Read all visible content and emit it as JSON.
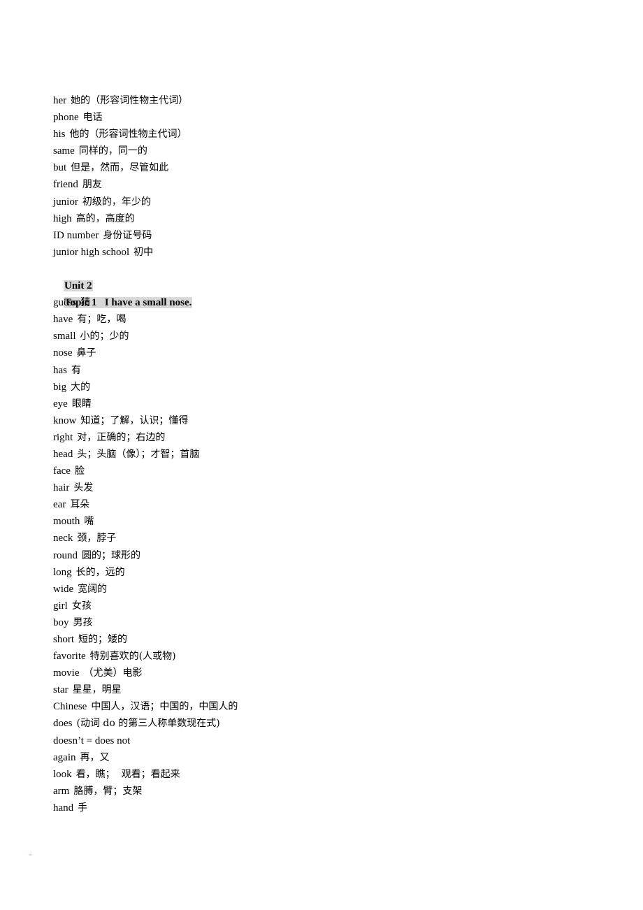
{
  "document": {
    "lines_before": [
      {
        "term": "her",
        "def": "她的（形容词性物主代词）"
      },
      {
        "term": "phone",
        "def": "电话"
      },
      {
        "term": "his",
        "def": "他的（形容词性物主代词）"
      },
      {
        "term": "same",
        "def": "同样的，同一的"
      },
      {
        "term": "but",
        "def": "但是，然而，尽管如此"
      },
      {
        "term": "friend",
        "def": "朋友"
      },
      {
        "term": "junior",
        "def": "初级的，年少的"
      },
      {
        "term": "high",
        "def": "高的，高度的"
      },
      {
        "term": "ID number",
        "def": "身份证号码"
      },
      {
        "term": "junior high school",
        "def": "初中"
      }
    ],
    "unit_heading": "Unit 2",
    "topic_heading": "Topic 1   I have a small nose.",
    "lines_after": [
      {
        "term": "guess",
        "def": "猜"
      },
      {
        "term": "have",
        "def": "有；吃，喝"
      },
      {
        "term": "small",
        "def": "小的；少的"
      },
      {
        "term": "nose",
        "def": "鼻子"
      },
      {
        "term": "has",
        "def": "有"
      },
      {
        "term": "big",
        "def": "大的"
      },
      {
        "term": "eye",
        "def": "眼睛"
      },
      {
        "term": "know",
        "def": "知道；了解，认识；懂得"
      },
      {
        "term": "right",
        "def": "对，正确的；右边的"
      },
      {
        "term": "head",
        "def": "头；头脑（像）；才智；首脑"
      },
      {
        "term": "face",
        "def": "脸"
      },
      {
        "term": "hair",
        "def": "头发"
      },
      {
        "term": "ear",
        "def": "耳朵"
      },
      {
        "term": "mouth",
        "def": "嘴"
      },
      {
        "term": "neck",
        "def": "颈，脖子"
      },
      {
        "term": "round",
        "def": "圆的；球形的"
      },
      {
        "term": "long",
        "def": "长的，远的"
      },
      {
        "term": "wide",
        "def": "宽阔的"
      },
      {
        "term": "girl",
        "def": "女孩"
      },
      {
        "term": "boy",
        "def": "男孩"
      },
      {
        "term": "short",
        "def": "短的；矮的"
      },
      {
        "term": "favorite",
        "def": "特别喜欢的(人或物)"
      },
      {
        "term": "movie",
        "def": "（尤美）电影"
      },
      {
        "term": "star",
        "def": "星星，明星"
      },
      {
        "term": "Chinese",
        "def": "中国人，汉语；中国的，中国人的"
      },
      {
        "term": "does",
        "def": "(动词 do 的第三人称单数现在式)"
      },
      {
        "term": "doesn’t = does not",
        "def": ""
      },
      {
        "term": "again",
        "def": "再，又"
      },
      {
        "term": "look",
        "def": "看，瞧；  观看；看起来"
      },
      {
        "term": "arm",
        "def": "胳膊，臂；支架"
      },
      {
        "term": "hand",
        "def": "手"
      }
    ]
  },
  "colors": {
    "heading_highlight": "#d9d9d9",
    "text": "#000000",
    "background": "#ffffff"
  }
}
